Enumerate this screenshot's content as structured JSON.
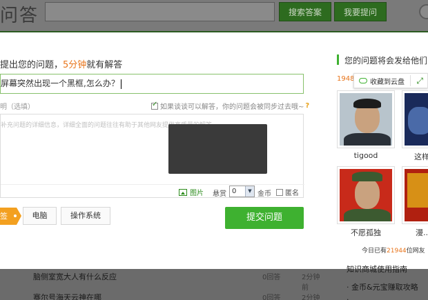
{
  "header": {
    "logo_text": "问答",
    "search_button": "搜索答案",
    "ask_button": "我要提问"
  },
  "modal": {
    "title_prefix": "提出您的问题，",
    "title_highlight": "5分钟",
    "title_suffix": "就有解答",
    "question_value": "屏幕突然出现一个黑框,怎么办？",
    "desc_label": "明（选填）",
    "allow_answer_label": "如果谈谈可以解答，你的问题会被同步过去哦~",
    "help_mark": "?",
    "desc_placeholder": "补充问题的详细信息，详细全面的问题往往有助于其他网友提供高质量的解答",
    "image_tool_label": "图片",
    "reward_label": "悬赏",
    "reward_value": "0",
    "coin_label": "金币",
    "anonymous_label": "匿名",
    "tag_arrow_text": "签",
    "tags": [
      "电脑",
      "操作系统"
    ],
    "submit_label": "提交问题"
  },
  "side": {
    "title": "您的问题将会发给他们",
    "number_prefix": "1948",
    "cloud_label": "收藏到云盘",
    "users": [
      "tigood",
      "这样",
      "不愿孤独",
      "漫..."
    ],
    "footer_prefix": "今日已有",
    "footer_count": "21944",
    "footer_suffix": "位网友"
  },
  "background_list": {
    "rows": [
      {
        "title": "脑侧室宽大人有什么反应",
        "count": "0回答",
        "time": "2分钟前"
      },
      {
        "title": "赛尔号海天云神在哪",
        "count": "0回答",
        "time": "2分钟前"
      }
    ],
    "side_items": [
      "知识商城使用指南",
      "· 金币&元宝赚取攻略",
      "·"
    ]
  },
  "colors": {
    "accent_green": "#3eb130",
    "highlight_orange": "#e8741a",
    "overlay_gray": "#6b6b6b"
  }
}
